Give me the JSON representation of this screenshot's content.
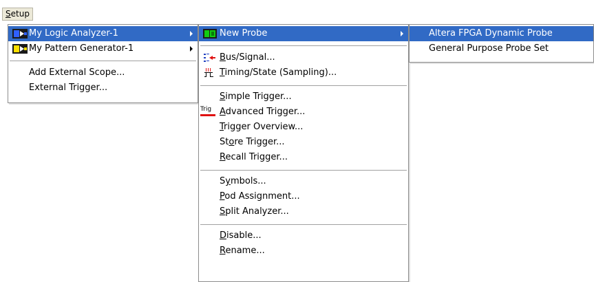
{
  "menubar": {
    "setup": {
      "prefix": "",
      "key": "S",
      "rest": "etup"
    }
  },
  "menu1": {
    "items": [
      {
        "label": "My Logic Analyzer-1"
      },
      {
        "label": "My Pattern Generator-1"
      },
      {
        "label": "Add External Scope..."
      },
      {
        "label": "External Trigger..."
      }
    ]
  },
  "menu2": {
    "new_probe": "New Probe",
    "trig_badge": "Trig",
    "bus_signal": {
      "prefix": "",
      "key": "B",
      "rest": "us/Signal..."
    },
    "timing_state": {
      "prefix": "",
      "key": "T",
      "rest": "iming/State (Sampling)..."
    },
    "simple_trigger": {
      "prefix": "",
      "key": "S",
      "rest": "imple Trigger..."
    },
    "advanced_trigger": {
      "prefix": "",
      "key": "A",
      "rest": "dvanced Trigger..."
    },
    "trigger_overview": {
      "prefix": "",
      "key": "T",
      "rest": "rigger Overview..."
    },
    "store_trigger": {
      "prefix": "St",
      "key": "o",
      "rest": "re Trigger..."
    },
    "recall_trigger": {
      "prefix": "",
      "key": "R",
      "rest": "ecall Trigger..."
    },
    "symbols": {
      "prefix": "S",
      "key": "y",
      "rest": "mbols..."
    },
    "pod_assignment": {
      "prefix": "",
      "key": "P",
      "rest": "od Assignment..."
    },
    "split_analyzer": {
      "prefix": "",
      "key": "S",
      "rest": "plit Analyzer..."
    },
    "disable": {
      "prefix": "",
      "key": "D",
      "rest": "isable..."
    },
    "rename": {
      "prefix": "",
      "key": "R",
      "rest": "ename..."
    }
  },
  "menu3": {
    "items": [
      {
        "label": "Altera FPGA Dynamic Probe"
      },
      {
        "label": "General Purpose Probe Set"
      }
    ]
  },
  "colors": {
    "highlight": "#316ac5",
    "menubar": "#ece9d8"
  }
}
